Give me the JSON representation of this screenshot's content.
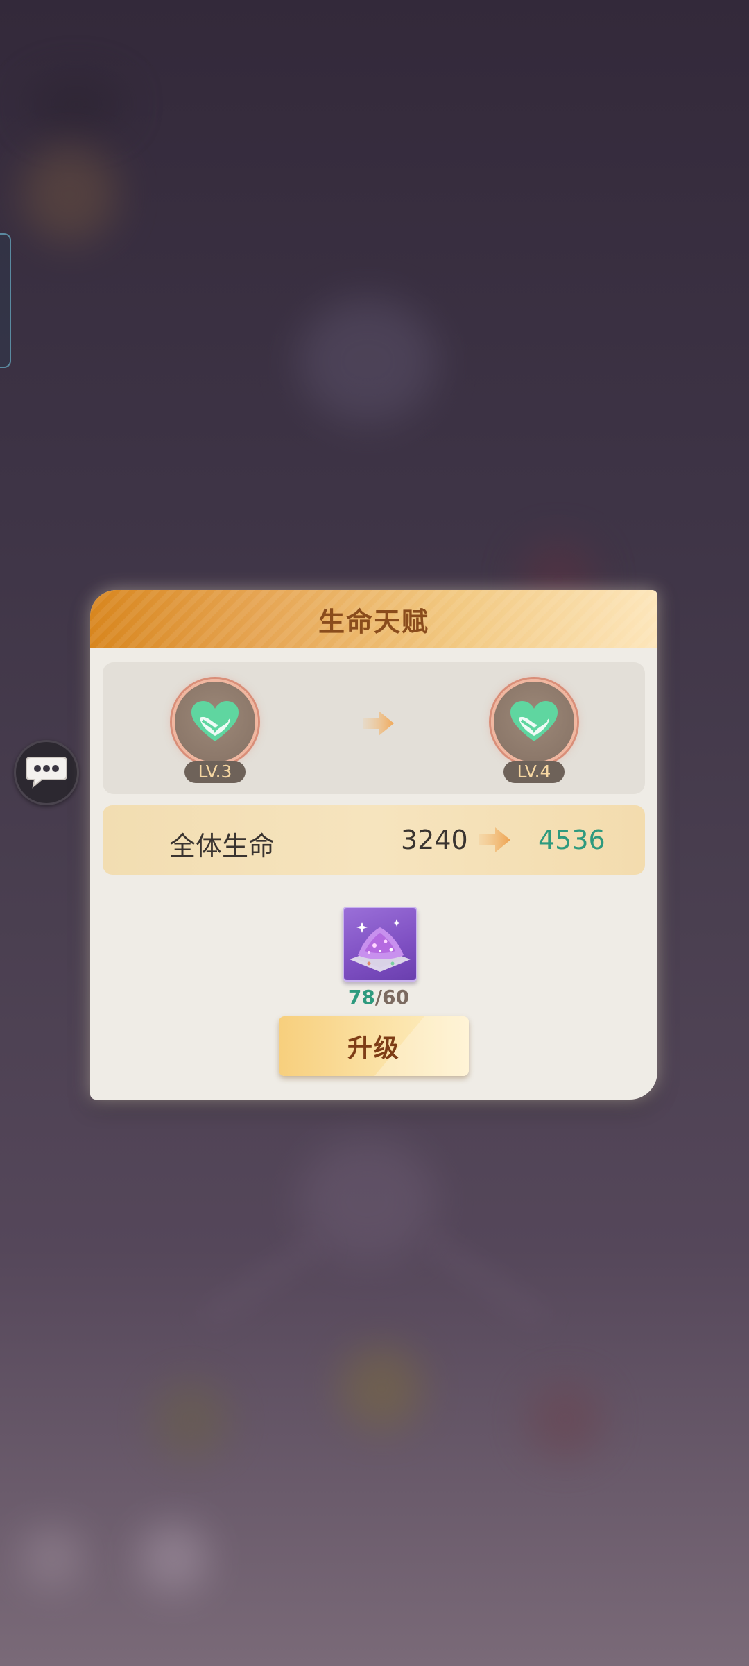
{
  "dialog": {
    "title": "生命天赋",
    "current_level": "LV.3",
    "next_level": "LV.4",
    "talent_icon": "heart-icon",
    "stat": {
      "label": "全体生命",
      "current_value": "3240",
      "next_value": "4536"
    },
    "cost": {
      "item_icon": "purple-crystal-icon",
      "owned": "78",
      "separator": "/",
      "required": "60"
    },
    "upgrade_label": "升级"
  },
  "side": {
    "chat_icon": "chat-bubble-icon"
  },
  "colors": {
    "header_gradient_start": "#d8861e",
    "header_gradient_end": "#fde6bb",
    "increase_value": "#2e9a7e",
    "heart": "#5fd6a0"
  }
}
